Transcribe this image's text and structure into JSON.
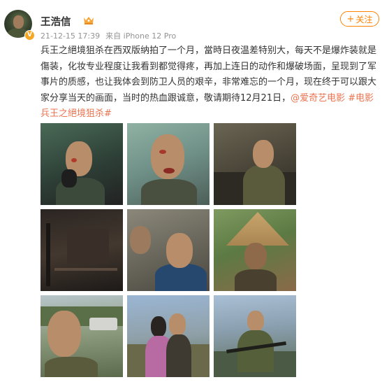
{
  "user": {
    "name": "王浩信",
    "avatar_icon": "avatar-soldier-photo",
    "verified_badge_icon": "verified-v-icon",
    "vip_icon": "vip-crown-icon"
  },
  "meta": {
    "date": "21-12-15 17:39",
    "source": "来自 iPhone 12 Pro"
  },
  "follow_button": {
    "label": "关注",
    "icon": "plus-icon"
  },
  "post": {
    "text": "兵王之絕境狙杀在西双版纳拍了一个月，當時日夜温差特别大，每天不是爆炸装就是傷装，化妆专业程度让我看到都觉得疼，再加上连日的动作和爆破场面，呈现到了军事片的质感，也让我体会到防卫人员的艰辛，非常难忘的一个月，现在终于可以跟大家分享当天的画面，当时的热血跟诚意，敬请期待12月21日，",
    "mention": "@爱奇艺电影",
    "hashtag": "#电影兵王之絕境狙杀#"
  },
  "photos": [
    {
      "name": "photo-makeup-bloody-face"
    },
    {
      "name": "photo-bloody-face-closeup"
    },
    {
      "name": "photo-soldier-in-jeep"
    },
    {
      "name": "photo-dark-night-set"
    },
    {
      "name": "photo-selfie-behind-scenes"
    },
    {
      "name": "photo-conical-straw-hat"
    },
    {
      "name": "photo-selfie-outdoor-road"
    },
    {
      "name": "photo-group-selfie-girl"
    },
    {
      "name": "photo-soldier-kneeling-rifle"
    }
  ],
  "colors": {
    "accent": "#ff8200",
    "link": "#eb7350",
    "meta_text": "#939393"
  }
}
